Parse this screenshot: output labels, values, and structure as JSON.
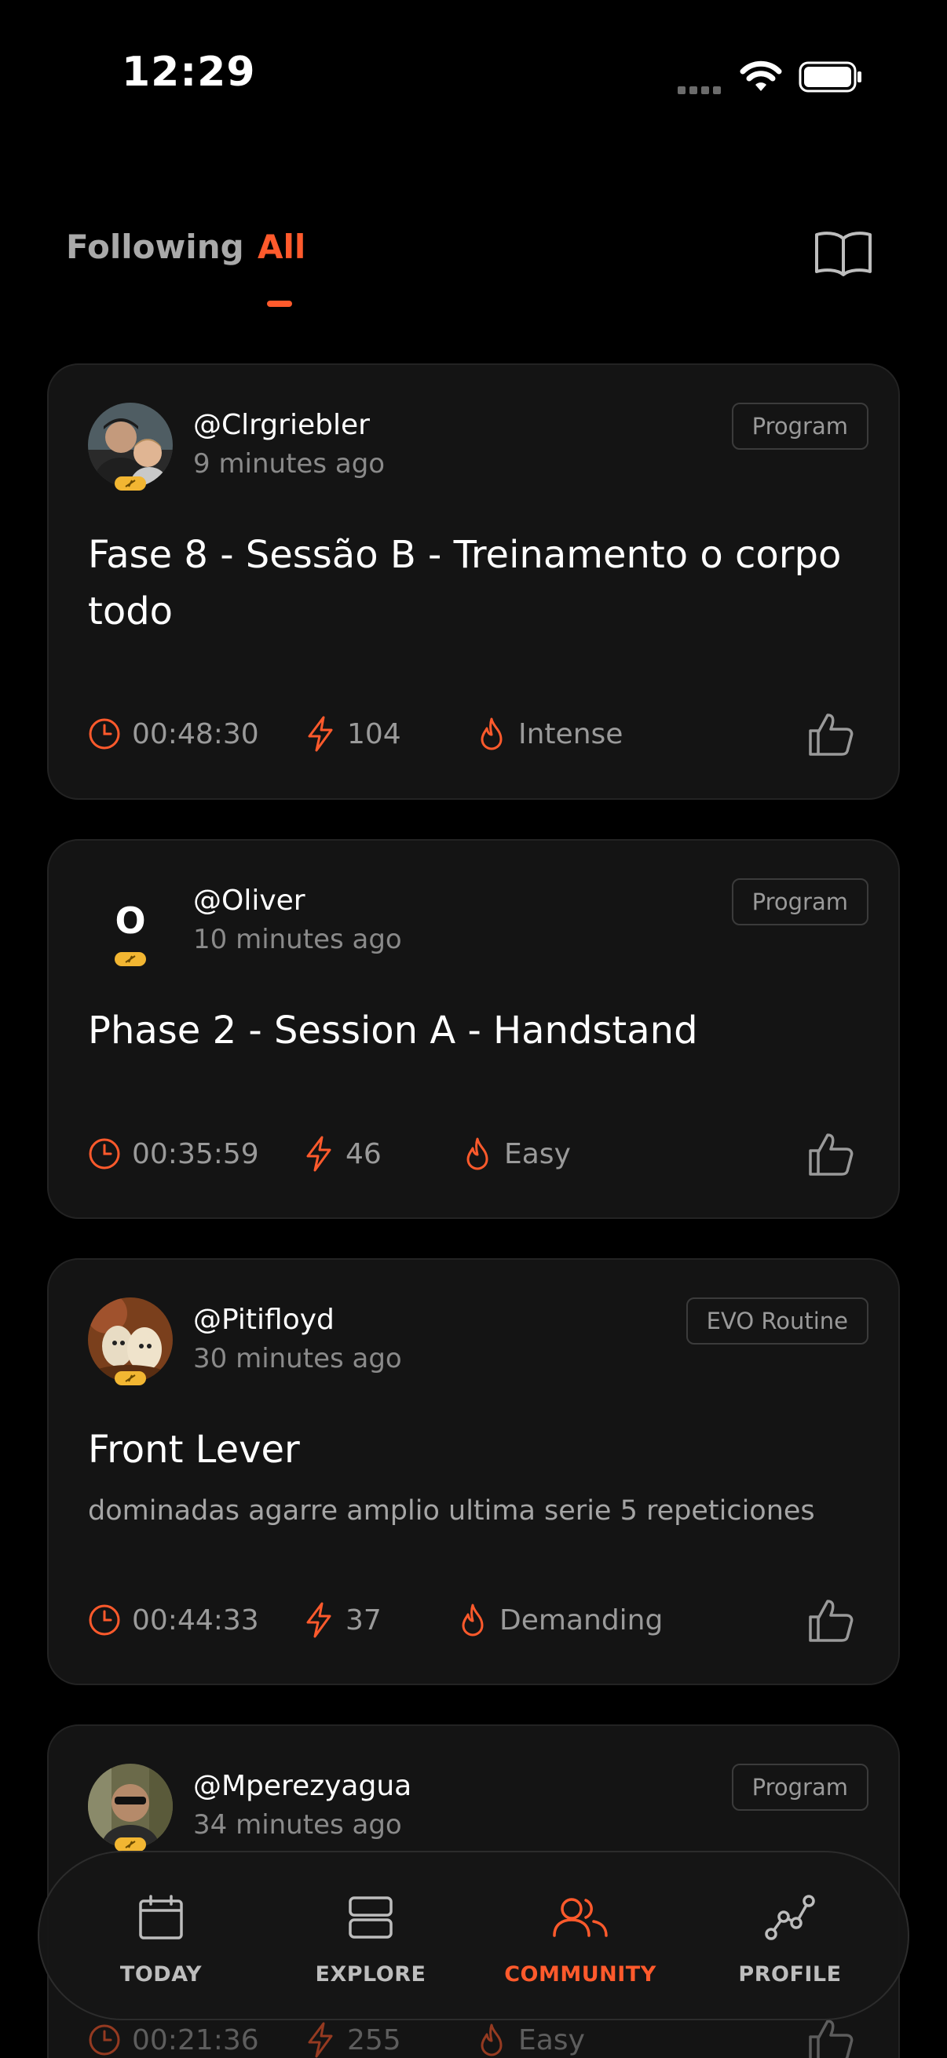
{
  "status_bar": {
    "time": "12:29"
  },
  "tabs": [
    {
      "label": "Following",
      "active": false
    },
    {
      "label": "All",
      "active": true
    }
  ],
  "colors": {
    "accent": "#ff5a2c",
    "card": "#141414",
    "badge": "#f2b632"
  },
  "feed": [
    {
      "username": "@Clrgriebler",
      "time_ago": "9 minutes ago",
      "tag": "Program",
      "title": "Fase 8 - Sessão B - Treinamento o corpo todo",
      "description": "",
      "duration": "00:48:30",
      "energy": "104",
      "intensity": "Intense",
      "avatar": "photo"
    },
    {
      "username": "@Oliver",
      "time_ago": "10 minutes ago",
      "tag": "Program",
      "title": "Phase 2 - Session A - Handstand",
      "description": "",
      "duration": "00:35:59",
      "energy": "46",
      "intensity": "Easy",
      "avatar_letter": "O"
    },
    {
      "username": "@Pitifloyd",
      "time_ago": "30 minutes ago",
      "tag": "EVO Routine",
      "title": "Front Lever",
      "description": "dominadas agarre amplio ultima serie 5 repeticiones",
      "duration": "00:44:33",
      "energy": "37",
      "intensity": "Demanding",
      "avatar": "photo"
    },
    {
      "username": "@Mperezyagua",
      "time_ago": "34 minutes ago",
      "tag": "Program",
      "title": "",
      "description": "",
      "duration": "00:21:36",
      "energy": "255",
      "intensity": "Easy",
      "avatar": "photo"
    }
  ],
  "nav": [
    {
      "label": "TODAY",
      "icon": "calendar-icon",
      "active": false
    },
    {
      "label": "EXPLORE",
      "icon": "explore-icon",
      "active": false
    },
    {
      "label": "COMMUNITY",
      "icon": "community-icon",
      "active": true
    },
    {
      "label": "PROFILE",
      "icon": "profile-chart-icon",
      "active": false
    }
  ]
}
